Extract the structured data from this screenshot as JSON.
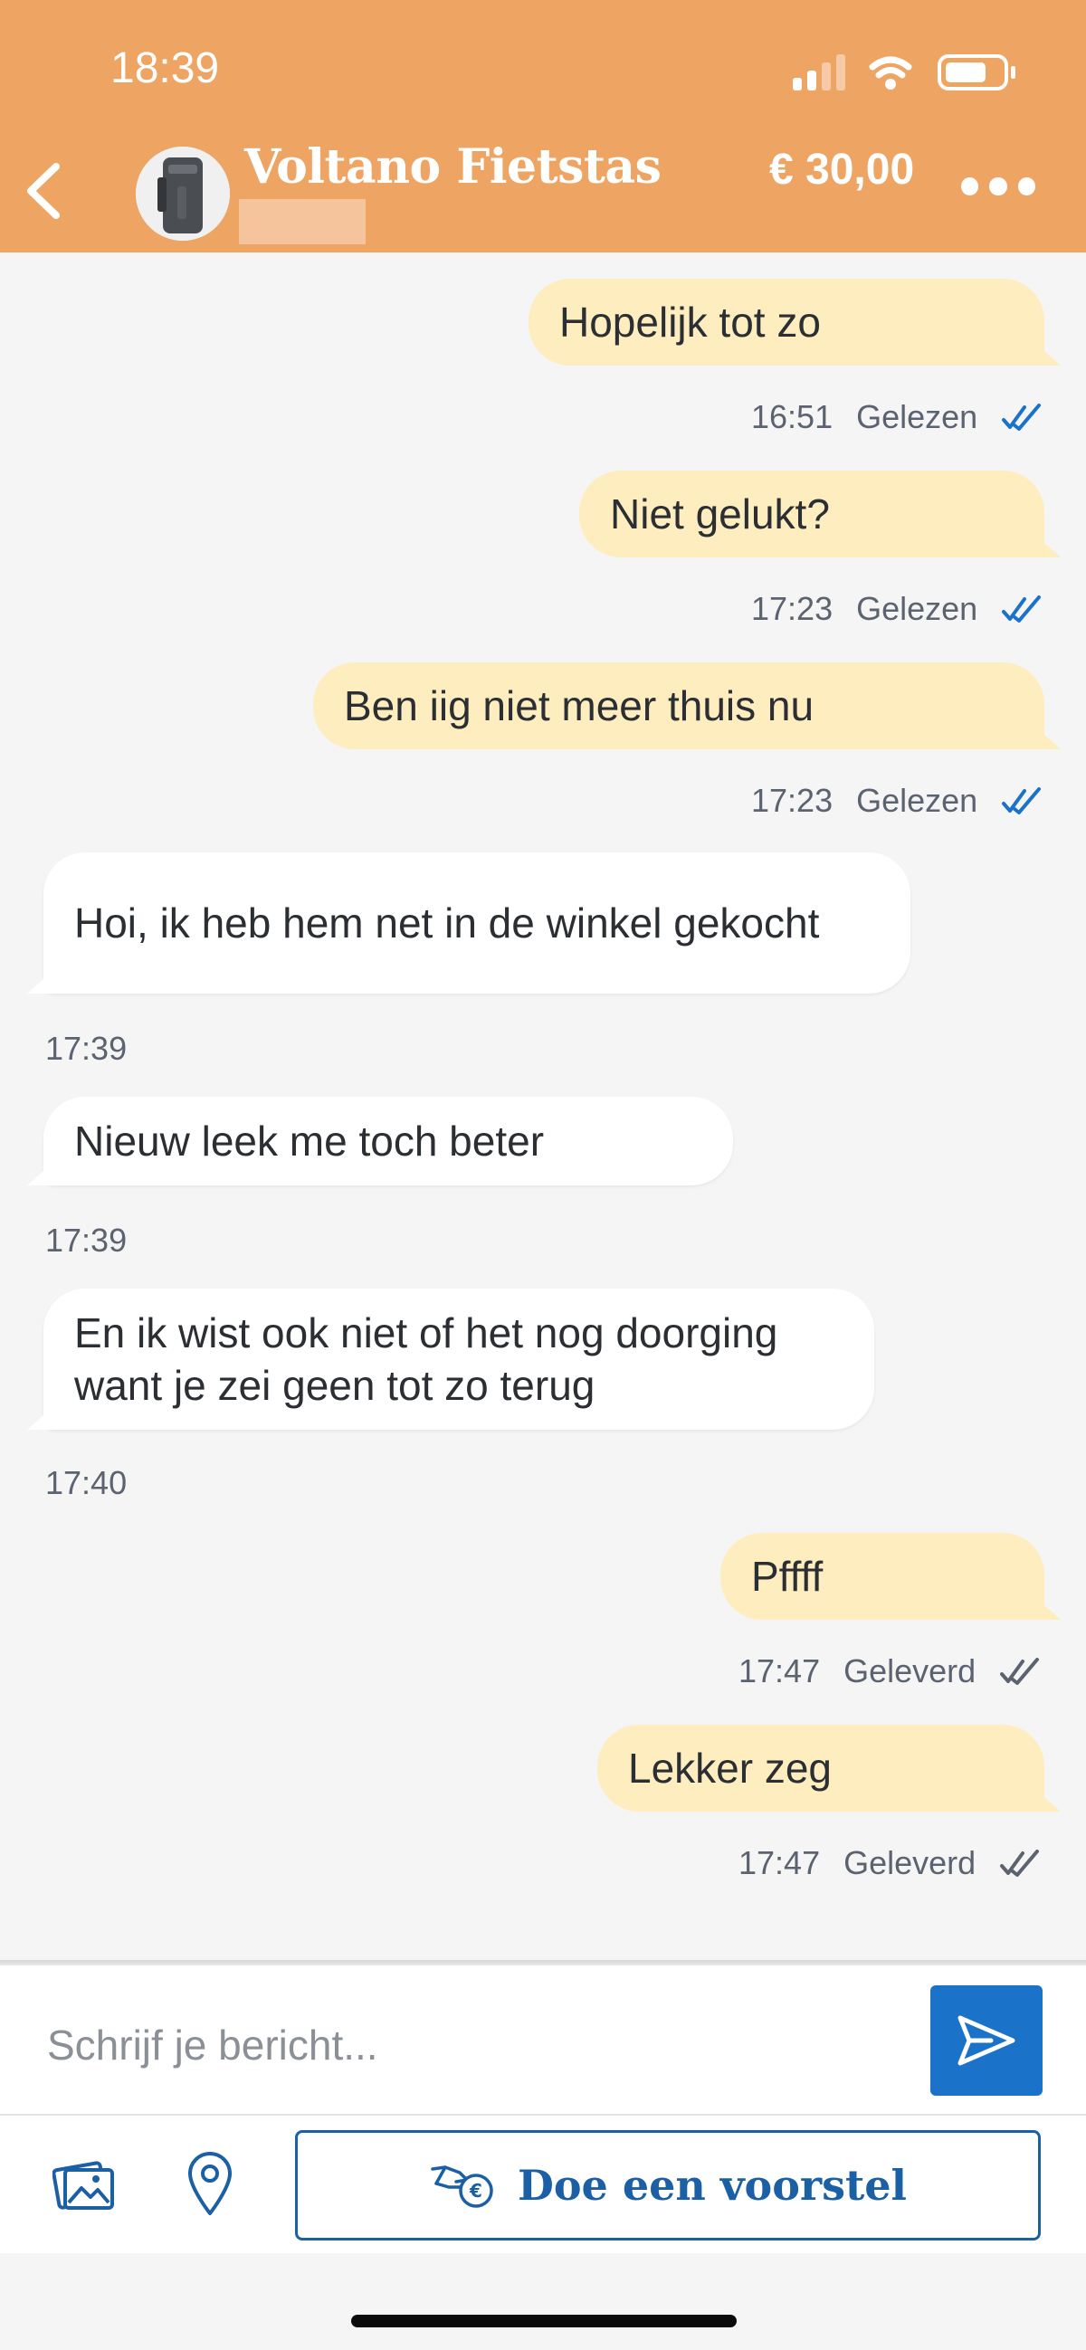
{
  "status_bar": {
    "time": "18:39"
  },
  "header": {
    "title": "Voltano Fietstas",
    "price": "€ 30,00"
  },
  "messages": [
    {
      "direction": "outgoing",
      "text": "Hopelijk tot zo",
      "time": "16:51",
      "status": "Gelezen"
    },
    {
      "direction": "outgoing",
      "text": "Niet gelukt?",
      "time": "17:23",
      "status": "Gelezen"
    },
    {
      "direction": "outgoing",
      "text": "Ben iig niet meer thuis nu",
      "time": "17:23",
      "status": "Gelezen"
    },
    {
      "direction": "incoming",
      "text": "Hoi, ik heb hem net in de winkel gekocht",
      "time": "17:39"
    },
    {
      "direction": "incoming",
      "text": "Nieuw leek me toch beter",
      "time": "17:39"
    },
    {
      "direction": "incoming",
      "text_line1": "En ik wist ook niet of het nog doorging",
      "text_line2": "want je zei geen tot zo terug",
      "time": "17:40"
    },
    {
      "direction": "outgoing",
      "text": "Pffff",
      "time": "17:47",
      "status": "Geleverd"
    },
    {
      "direction": "outgoing",
      "text": "Lekker zeg",
      "time": "17:47",
      "status": "Geleverd"
    }
  ],
  "composer": {
    "placeholder": "Schrijf je bericht..."
  },
  "toolbar": {
    "offer_label": "Doe een voorstel"
  },
  "colors": {
    "header": "#eea564",
    "outgoing_bubble": "#fdedbf",
    "incoming_bubble": "#ffffff",
    "accent_blue": "#1b73c9",
    "read_tick": "#1b73c9",
    "delivered_tick": "#5c6370"
  },
  "icons": [
    "back-icon",
    "more-icon",
    "read-check-icon",
    "delivered-check-icon",
    "send-icon",
    "gallery-icon",
    "location-icon",
    "offer-hand-icon"
  ]
}
